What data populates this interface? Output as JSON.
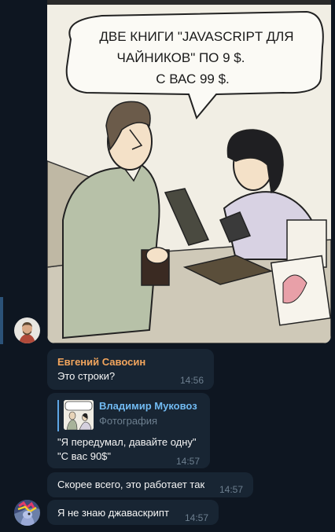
{
  "photo": {
    "speech_bubble_lines": [
      "ДВЕ КНИГИ \"JAVASCRIPT ДЛЯ",
      "ЧАЙНИКОВ\" ПО 9 $.",
      "С ВАС 99 $."
    ]
  },
  "messages": [
    {
      "sender": "Евгений Савосин",
      "text": "Это строки?",
      "time": "14:56"
    },
    {
      "reply": {
        "author": "Владимир Муковоз",
        "kind": "Фотография"
      },
      "text_line1": "\"Я передумал, давайте одну\"",
      "text_line2": "\"С вас 90$\"",
      "time": "14:57"
    },
    {
      "text": "Скорее всего, это работает так",
      "time": "14:57"
    },
    {
      "text": "Я не знаю джаваскрипт",
      "time": "14:57"
    }
  ],
  "colors": {
    "background": "#0e1621",
    "bubble": "#182533",
    "sender_name": "#f2a55d",
    "reply_author": "#71baf2",
    "timestamp": "#6d7f8f"
  }
}
